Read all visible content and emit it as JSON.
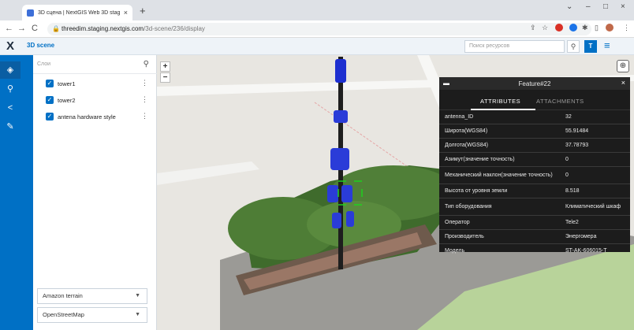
{
  "browser": {
    "tab_title": "3D сцена | NextGIS Web 3D stag...",
    "tab_close": "×",
    "new_tab": "+",
    "url_host": "threedim.staging.nextgis.com",
    "url_path": "/3d-scene/236/display",
    "win_min": "–",
    "win_max": "□",
    "win_close": "×"
  },
  "app": {
    "logo": "X",
    "title": "3D scene",
    "search_placeholder": "Поиск ресурсов",
    "user_initial": "T",
    "menu_icon": "≡"
  },
  "layers_panel": {
    "header": "Слои",
    "layers": [
      {
        "label": "tower1"
      },
      {
        "label": "tower2"
      },
      {
        "label": "antena hardware style"
      }
    ],
    "basemaps": [
      {
        "label": "Amazon terrain"
      },
      {
        "label": "OpenStreetMap"
      }
    ]
  },
  "map": {
    "zoom_in": "+",
    "zoom_out": "−"
  },
  "feature": {
    "title": "Feature#22",
    "close": "×",
    "tabs": [
      "ATTRIBUTES",
      "ATTACHMENTS"
    ],
    "rows": [
      {
        "k": "antenna_ID",
        "v": "32"
      },
      {
        "k": "Широта(WGS84)",
        "v": "55.91484"
      },
      {
        "k": "Долгота(WGS84)",
        "v": "37.78793"
      },
      {
        "k": "Азимут(значение точность)",
        "v": "0"
      },
      {
        "k": "Механический наклон(значение точность)",
        "v": "0"
      },
      {
        "k": "Высота от уровня земли",
        "v": "8.518"
      },
      {
        "k": "Тип оборудования",
        "v": "Климатический шкаф"
      },
      {
        "k": "Оператор",
        "v": "Tele2"
      },
      {
        "k": "Производитель",
        "v": "Энергомера"
      },
      {
        "k": "Модель",
        "v": "ST-AK-606015-T"
      }
    ]
  },
  "colors": {
    "accent": "#0070c5",
    "popup_bg": "#1c1c1c"
  }
}
